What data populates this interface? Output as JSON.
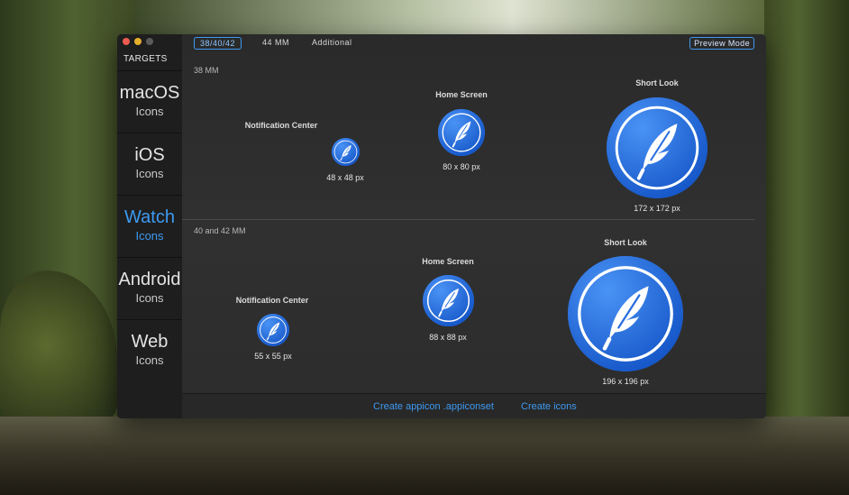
{
  "colors": {
    "accent": "#3d9af2",
    "icon_blue": "#2b6fe0"
  },
  "sidebar": {
    "header": "TARGETS",
    "items": [
      {
        "name": "macOS",
        "sub": "Icons"
      },
      {
        "name": "iOS",
        "sub": "Icons"
      },
      {
        "name": "Watch",
        "sub": "Icons",
        "active": true
      },
      {
        "name": "Android",
        "sub": "Icons"
      },
      {
        "name": "Web",
        "sub": "Icons"
      }
    ]
  },
  "tabs": [
    {
      "label": "38/40/42",
      "active": true
    },
    {
      "label": "44 MM"
    },
    {
      "label": "Additional"
    }
  ],
  "preview_mode": "Preview Mode",
  "sections": [
    {
      "label": "38 MM",
      "icons": [
        {
          "title": "Notification Center",
          "size": "48 x 48 px",
          "icon": "feather-icon"
        },
        {
          "title": "Home Screen",
          "size": "80 x 80 px",
          "icon": "feather-icon"
        },
        {
          "title": "Short Look",
          "size": "172 x 172 px",
          "icon": "feather-icon"
        }
      ]
    },
    {
      "label": "40 and 42 MM",
      "icons": [
        {
          "title": "Notification Center",
          "size": "55 x 55 px",
          "icon": "feather-icon"
        },
        {
          "title": "Home Screen",
          "size": "88 x 88 px",
          "icon": "feather-icon"
        },
        {
          "title": "Short Look",
          "size": "196 x 196 px",
          "icon": "feather-icon"
        }
      ]
    }
  ],
  "footer": {
    "create_appiconset": "Create appicon .appiconset",
    "create_icons": "Create icons"
  }
}
